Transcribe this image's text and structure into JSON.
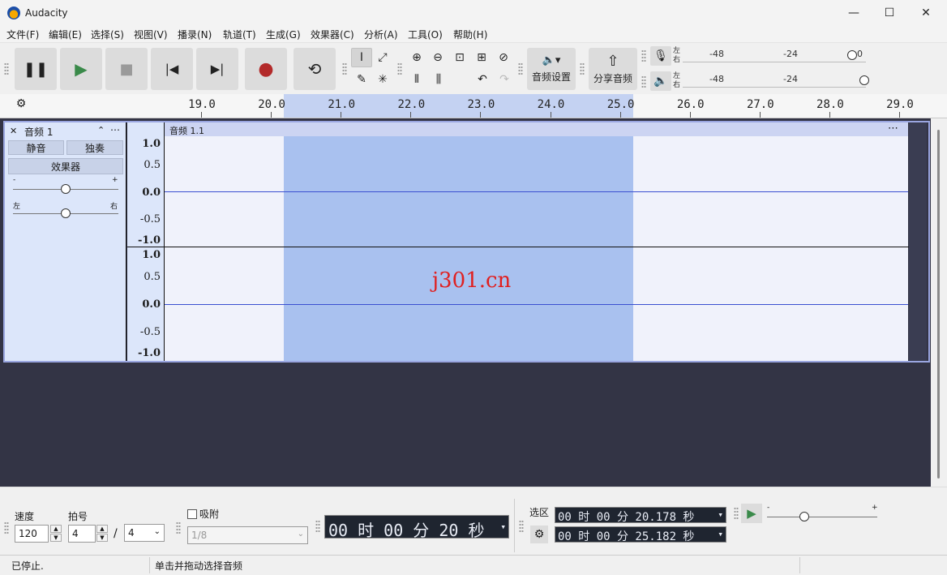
{
  "window": {
    "title": "Audacity",
    "minimize": "—",
    "maximize": "☐",
    "close": "✕"
  },
  "menu": [
    "文件(F)",
    "编辑(E)",
    "选择(S)",
    "视图(V)",
    "播录(N)",
    "轨道(T)",
    "生成(G)",
    "效果器(C)",
    "分析(A)",
    "工具(O)",
    "帮助(H)"
  ],
  "transport": {
    "pause": "❚❚",
    "play": "▶",
    "stop": "■",
    "skip_start": "|◀",
    "skip_end": "▶|",
    "record": "●",
    "loop": "⟲"
  },
  "tools": {
    "select": "I",
    "envelope": "⤢",
    "draw": "✎",
    "multi": "✳",
    "zoom_in": "⊕",
    "zoom_out": "⊖",
    "zoom_sel": "⊡",
    "zoom_fit": "⊞",
    "zoom_toggle": "⊘",
    "trim": "⫴",
    "silence": "⫼",
    "undo": "↶",
    "redo": "↷"
  },
  "audio_setup": {
    "icon": "🔈▾",
    "label": "音频设置"
  },
  "share": {
    "icon": "⇧",
    "label": "分享音频"
  },
  "meters": {
    "record": {
      "left": "左",
      "right": "右",
      "ticks": [
        "-48",
        "-24",
        "0"
      ]
    },
    "play": {
      "left": "左",
      "right": "右",
      "ticks": [
        "-48",
        "-24"
      ]
    }
  },
  "ruler": {
    "labels": [
      "19.0",
      "20.0",
      "21.0",
      "22.0",
      "23.0",
      "24.0",
      "25.0",
      "26.0",
      "27.0",
      "28.0",
      "29.0"
    ]
  },
  "track": {
    "name": "音频 1",
    "close": "✕",
    "collapse": "⌃",
    "menu": "⋯",
    "mute": "静音",
    "solo": "独奏",
    "effects": "效果器",
    "gain_min": "-",
    "gain_max": "+",
    "pan_left": "左",
    "pan_right": "右",
    "clip_name": "音频 1.1",
    "clip_menu": "⋯",
    "ch1_scale": [
      "1.0",
      "0.5",
      "0.0",
      "-0.5",
      "-1.0"
    ],
    "ch2_scale": [
      "1.0",
      "0.5",
      "0.0",
      "-0.5",
      "-1.0"
    ]
  },
  "watermark": "j301.cn",
  "bottom": {
    "tempo_label": "速度",
    "tempo_value": "120",
    "beats_label": "拍号",
    "beats_value": "4",
    "slash": "/",
    "beats_unit": "4",
    "snap_label": "吸附",
    "snap_value": "1/8",
    "time_display": "00 时 00 分 20 秒",
    "selection_label": "选区",
    "sel_start": "00 时 00 分 20.178 秒",
    "sel_end": "00 时 00 分 25.182 秒",
    "speed_min": "-",
    "speed_max": "+"
  },
  "status": {
    "state": "已停止.",
    "hint": "单击并拖动选择音频"
  }
}
